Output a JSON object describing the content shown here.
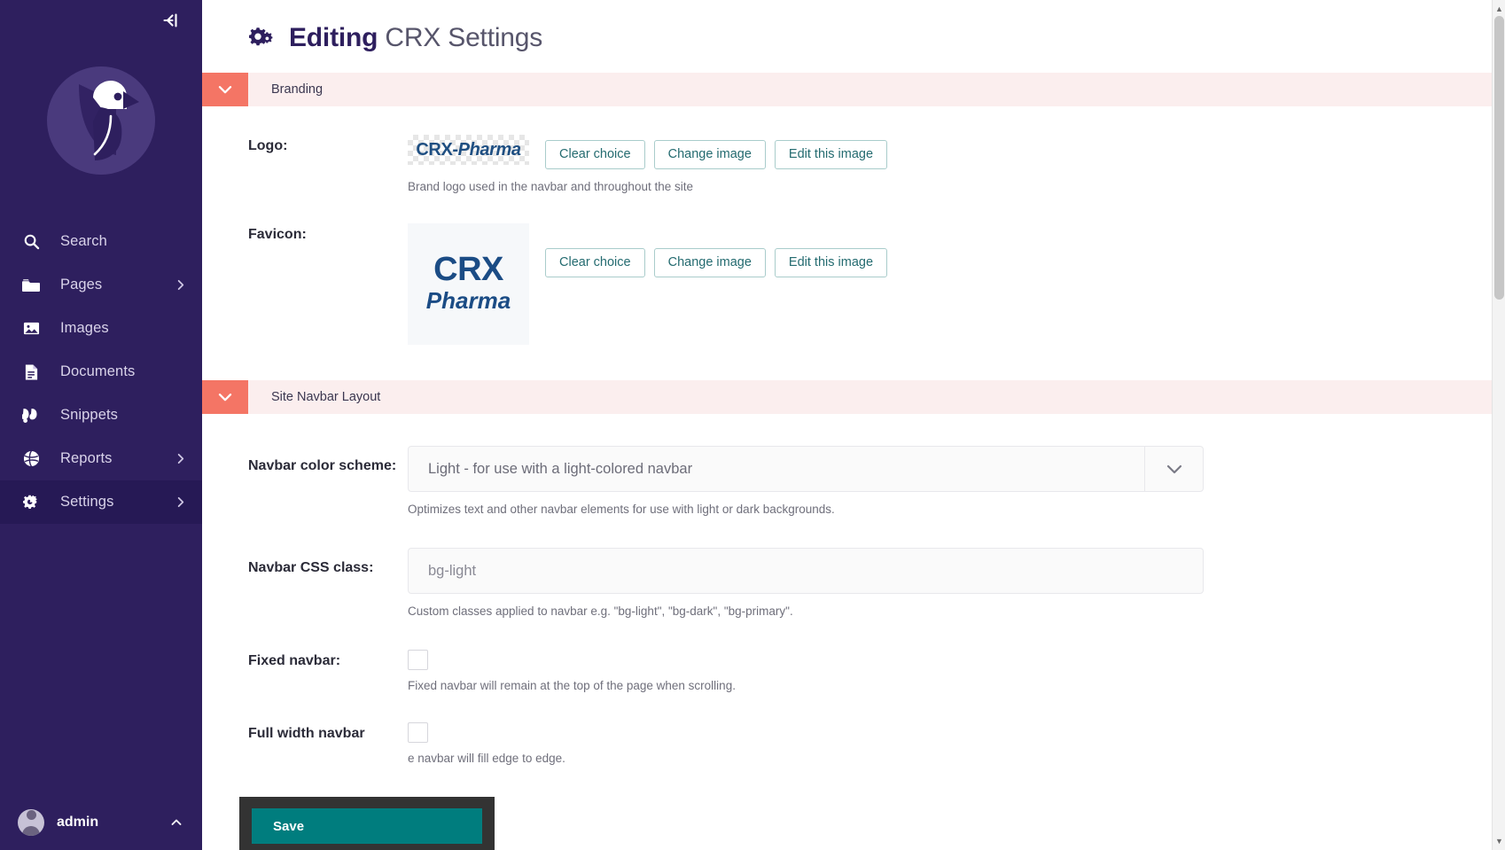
{
  "sidebar": {
    "collapse_icon": "collapse-left-icon",
    "logo_icon": "wagtail-bird-logo",
    "items": [
      {
        "label": "Search",
        "icon": "search-icon",
        "has_chevron": false,
        "active": false
      },
      {
        "label": "Pages",
        "icon": "folder-icon",
        "has_chevron": true,
        "active": false
      },
      {
        "label": "Images",
        "icon": "image-icon",
        "has_chevron": false,
        "active": false
      },
      {
        "label": "Documents",
        "icon": "document-icon",
        "has_chevron": false,
        "active": false
      },
      {
        "label": "Snippets",
        "icon": "snippets-icon",
        "has_chevron": false,
        "active": false
      },
      {
        "label": "Reports",
        "icon": "globe-icon",
        "has_chevron": true,
        "active": false
      },
      {
        "label": "Settings",
        "icon": "gears-icon",
        "has_chevron": true,
        "active": true
      }
    ],
    "footer": {
      "user_name": "admin",
      "avatar_icon": "avatar",
      "chevron_icon": "chevron-up-icon"
    }
  },
  "header": {
    "icon": "gears-icon",
    "title_bold": "Editing",
    "title_rest": "CRX Settings"
  },
  "panels": [
    {
      "title": "Branding",
      "toggle_icon": "chevron-down-icon"
    },
    {
      "title": "Site Navbar Layout",
      "toggle_icon": "chevron-down-icon"
    }
  ],
  "branding": {
    "logo": {
      "label": "Logo:",
      "thumb_text_1": "CRX-",
      "thumb_text_2": "Pharma",
      "buttons": [
        "Clear choice",
        "Change image",
        "Edit this image"
      ],
      "help": "Brand logo used in the navbar and throughout the site"
    },
    "favicon": {
      "label": "Favicon:",
      "thumb_line1": "CRX",
      "thumb_line2": "Pharma",
      "buttons": [
        "Clear choice",
        "Change image",
        "Edit this image"
      ]
    }
  },
  "navbar_layout": {
    "color_scheme": {
      "label": "Navbar color scheme:",
      "value": "Light - for use with a light-colored navbar",
      "arrow_icon": "chevron-down-icon",
      "help": "Optimizes text and other navbar elements for use with light or dark backgrounds."
    },
    "css_class": {
      "label": "Navbar CSS class:",
      "value": "bg-light",
      "placeholder": "bg-light",
      "help": "Custom classes applied to navbar e.g. \"bg-light\", \"bg-dark\", \"bg-primary\"."
    },
    "fixed_navbar": {
      "label": "Fixed navbar:",
      "checked": false,
      "help": "Fixed navbar will remain at the top of the page when scrolling."
    },
    "full_width_navbar": {
      "label": "Full width navbar",
      "checked": false,
      "help": "e navbar will fill edge to edge."
    }
  },
  "footer": {
    "save_label": "Save"
  },
  "colors": {
    "sidebar_bg": "#2E1F5E",
    "sidebar_active": "#261955",
    "panel_header_bg": "#FBEEEE",
    "panel_toggle_bg": "#F47565",
    "accent_teal": "#007D7E",
    "button_border": "#A9CCCB",
    "button_text": "#246B70",
    "title_dark": "#2E1F5E"
  }
}
